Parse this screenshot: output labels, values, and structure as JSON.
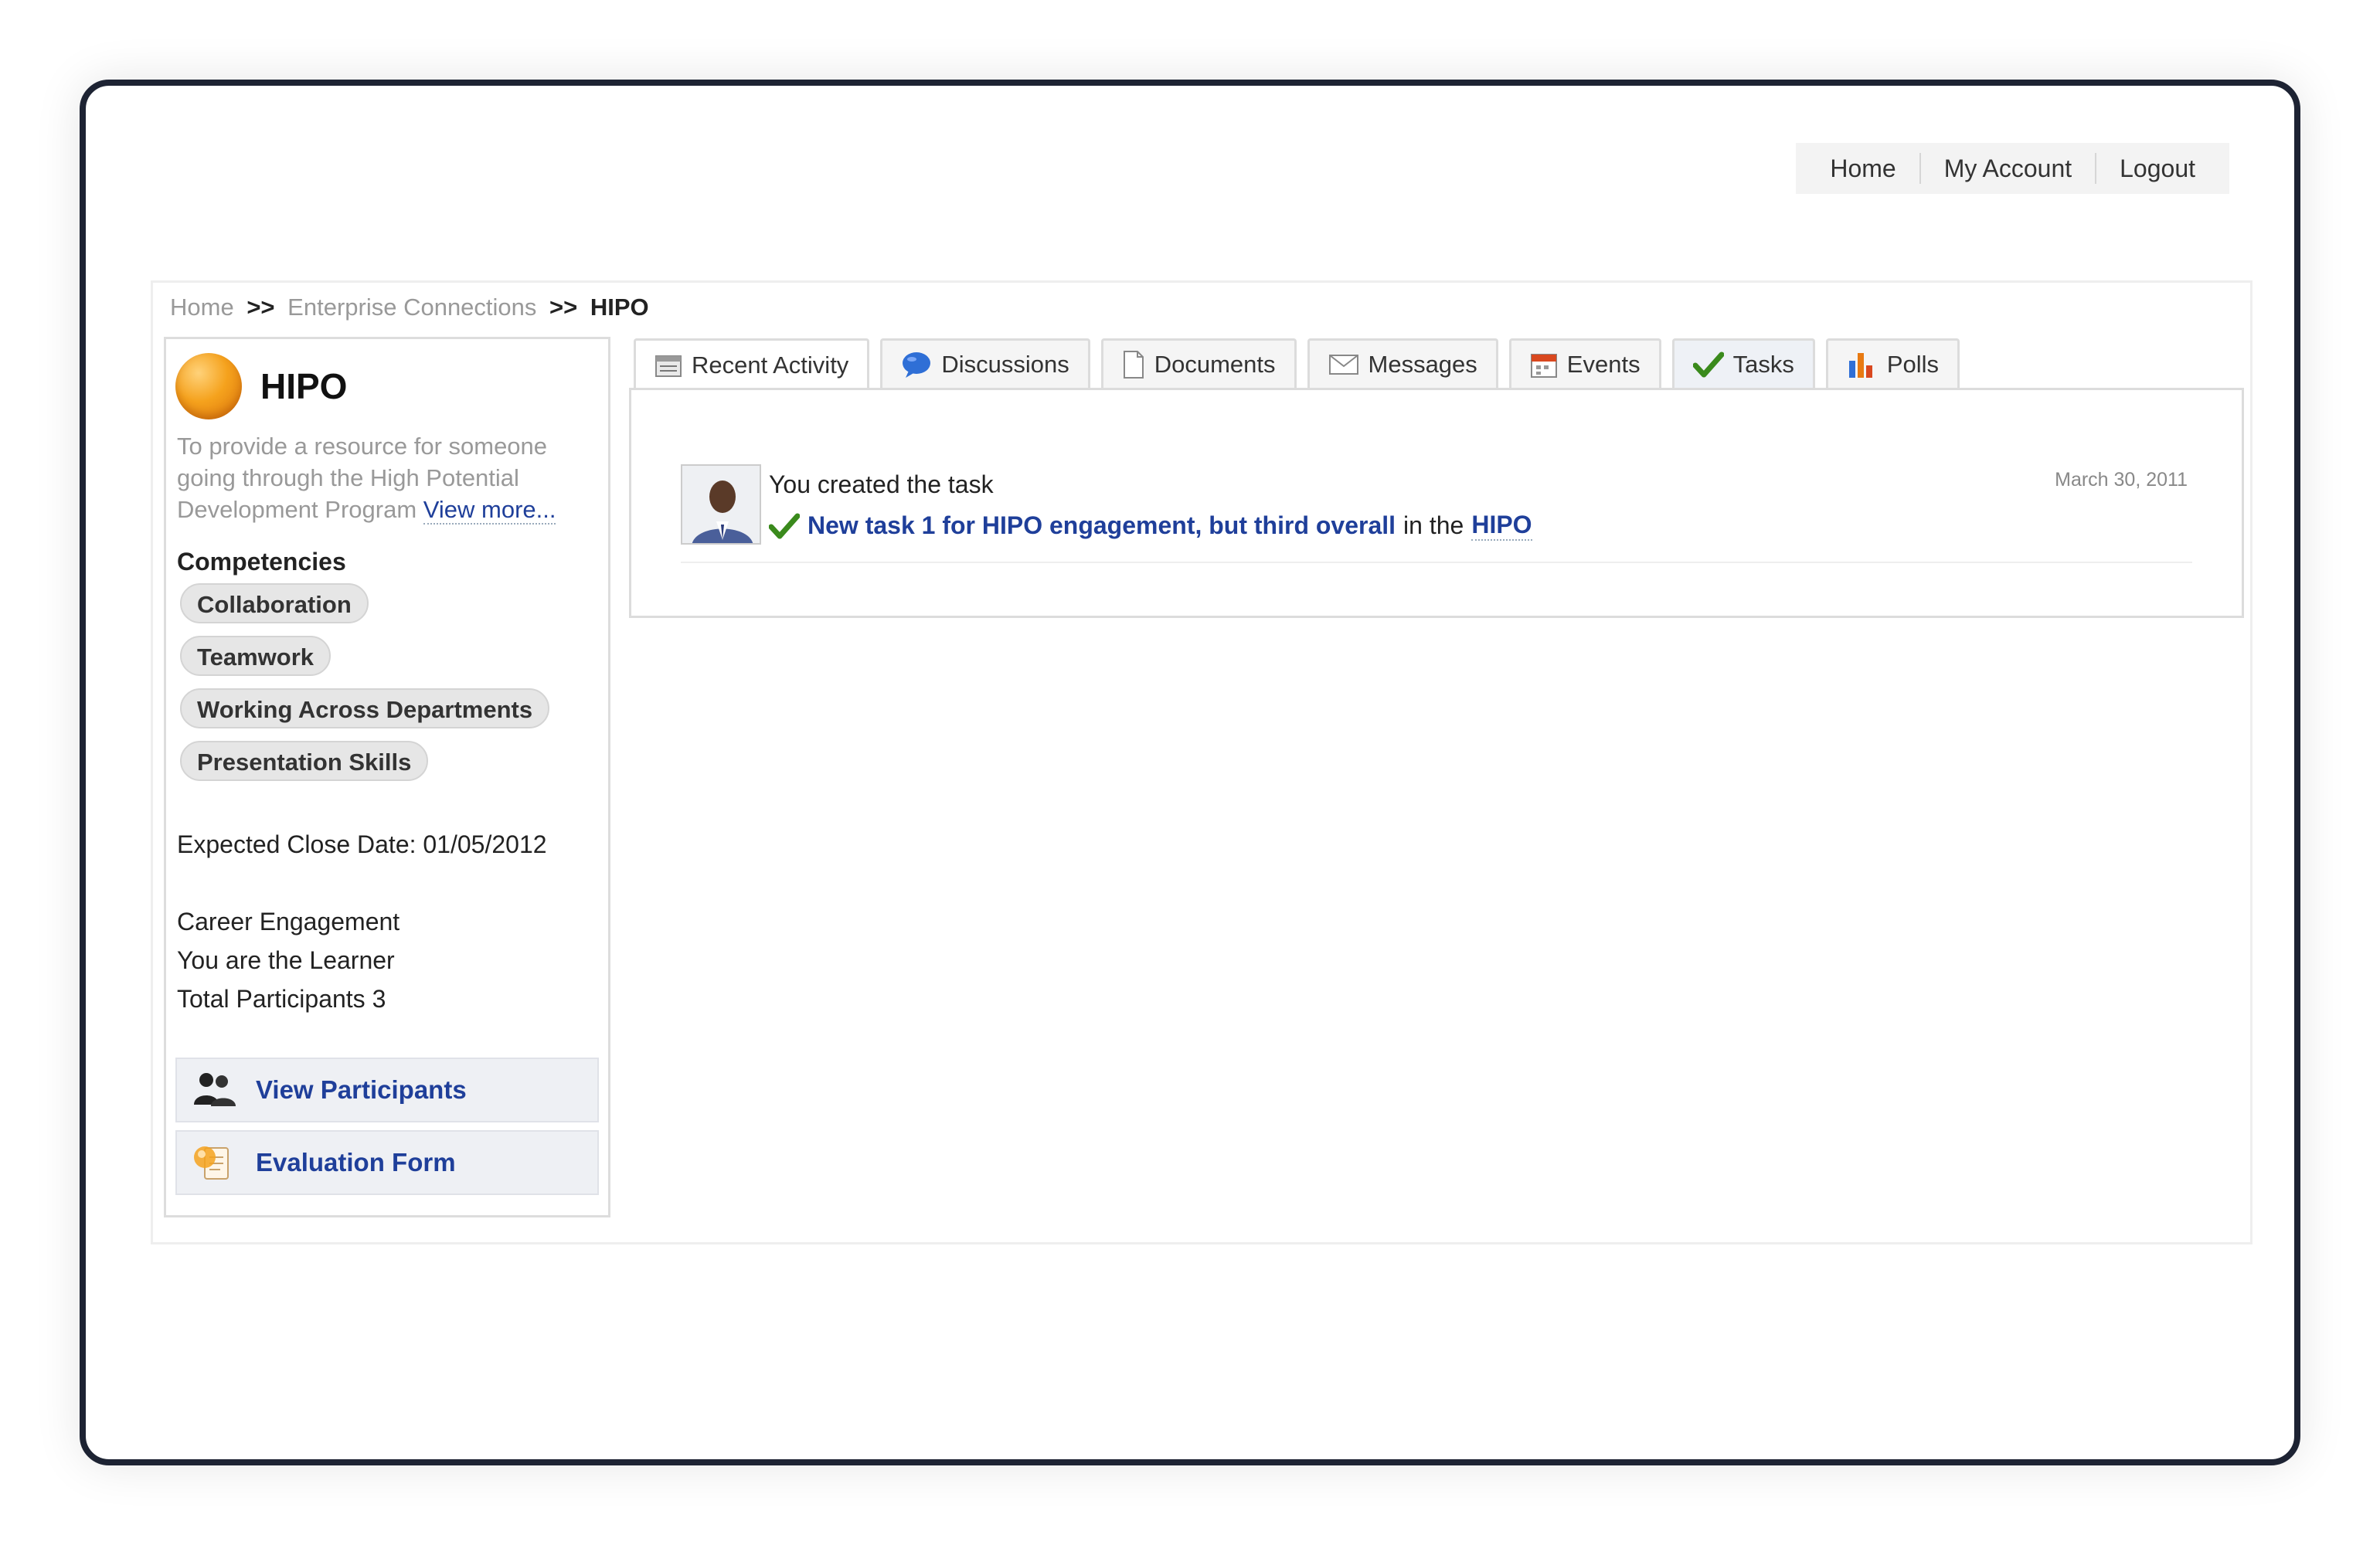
{
  "topnav": {
    "home": "Home",
    "account": "My Account",
    "logout": "Logout"
  },
  "breadcrumb": {
    "home": "Home",
    "sep": ">>",
    "parent": "Enterprise Connections",
    "current": "HIPO"
  },
  "group": {
    "title": "HIPO",
    "description": "To provide a resource for someone going through the High Potential Development Program",
    "view_more": "View more...",
    "competencies_label": "Competencies",
    "competencies": [
      "Collaboration",
      "Teamwork",
      "Working Across Departments",
      "Presentation Skills"
    ],
    "expected_close": "Expected Close Date: 01/05/2012",
    "engagement": "Career Engagement",
    "role": "You are the Learner",
    "participants": "Total Participants 3",
    "actions": {
      "view_participants": "View Participants",
      "evaluation_form": "Evaluation Form"
    }
  },
  "tabs": [
    {
      "label": "Recent Activity",
      "icon": "calendar-list-icon",
      "active": true
    },
    {
      "label": "Discussions",
      "icon": "speech-bubble-icon",
      "active": false
    },
    {
      "label": "Documents",
      "icon": "document-icon",
      "active": false
    },
    {
      "label": "Messages",
      "icon": "envelope-icon",
      "active": false
    },
    {
      "label": "Events",
      "icon": "calendar-icon",
      "active": false
    },
    {
      "label": "Tasks",
      "icon": "checkmark-icon",
      "active": false
    },
    {
      "label": "Polls",
      "icon": "bar-chart-icon",
      "active": false
    }
  ],
  "activity": {
    "line1": "You created the task",
    "task_link": "New task 1 for HIPO engagement, but third overall",
    "in_the": "in the",
    "group_link": "HIPO",
    "date": "March 30, 2011"
  },
  "colors": {
    "link": "#1f3f9a",
    "frame": "#1d2333",
    "accent_orange": "#f5a21d",
    "check_green": "#3a8a1c"
  }
}
